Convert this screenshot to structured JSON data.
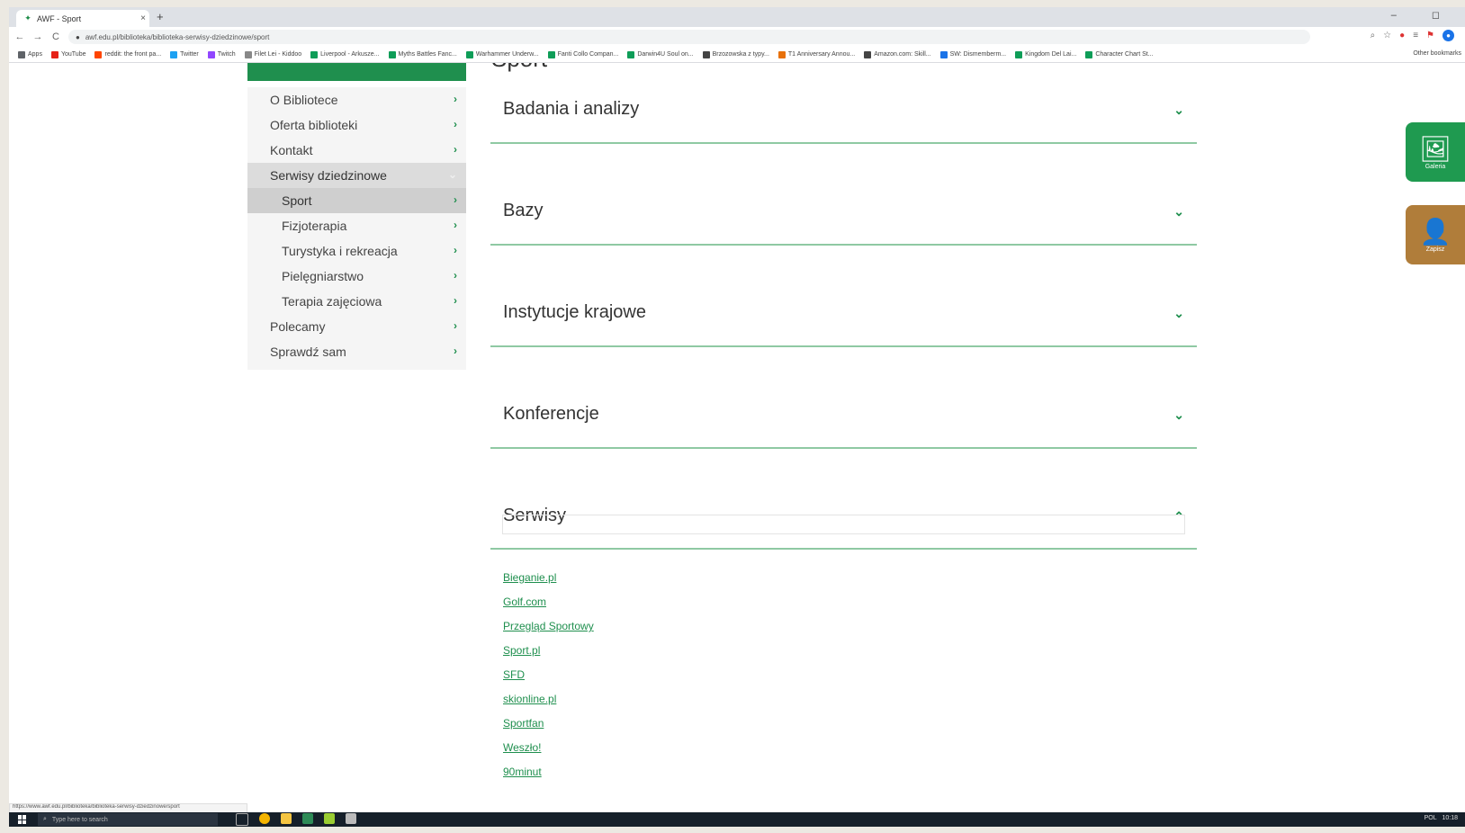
{
  "browser": {
    "tab_title": "AWF - Sport",
    "tab_close": "×",
    "new_tab": "+",
    "window_controls": "–  ◻",
    "nav": {
      "back": "←",
      "forward": "→",
      "reload": "C"
    },
    "url": "awf.edu.pl/biblioteka/biblioteka-serwisy-dziedzinowe/sport",
    "bookmarks": [
      {
        "label": "Apps",
        "color": "#5f6368"
      },
      {
        "label": "YouTube",
        "color": "#e62117"
      },
      {
        "label": "reddit: the front pa...",
        "color": "#ff4500"
      },
      {
        "label": "Twitter",
        "color": "#1da1f2"
      },
      {
        "label": "Twitch",
        "color": "#9146ff"
      },
      {
        "label": "Filet Lei - Kiddoo",
        "color": "#888888"
      },
      {
        "label": "Liverpool - Arkusze...",
        "color": "#0f9d58"
      },
      {
        "label": "Myths Battles Fanc...",
        "color": "#0f9d58"
      },
      {
        "label": "Warhammer Underw...",
        "color": "#0f9d58"
      },
      {
        "label": "Fanti Collo Compan...",
        "color": "#0f9d58"
      },
      {
        "label": "Darwin4U Soul on...",
        "color": "#0f9d58"
      },
      {
        "label": "Brzozowska z typy...",
        "color": "#444444"
      },
      {
        "label": "T1 Anniversary Annou...",
        "color": "#e8710a"
      },
      {
        "label": "Amazon.com: Skill...",
        "color": "#444444"
      },
      {
        "label": "SW: Dismemberm...",
        "color": "#1a73e8"
      },
      {
        "label": "Kingdom Del Lai...",
        "color": "#0f9d58"
      },
      {
        "label": "Character Chart St...",
        "color": "#0f9d58"
      }
    ],
    "other_bookmarks": "Other bookmarks",
    "status_url": "https://www.awf.edu.pl/biblioteka/biblioteka-serwisy-dziedzinowe/sport"
  },
  "page": {
    "title": "Sport",
    "sidebar": {
      "items": [
        {
          "label": "O Bibliotece",
          "level": "top",
          "state": "normal",
          "chev": "›"
        },
        {
          "label": "Oferta biblioteki",
          "level": "top",
          "state": "normal",
          "chev": "›"
        },
        {
          "label": "Kontakt",
          "level": "top",
          "state": "normal",
          "chev": "›"
        },
        {
          "label": "Serwisy dziedzinowe",
          "level": "top",
          "state": "active-parent",
          "chev": "⌄"
        },
        {
          "label": "Sport",
          "level": "sub",
          "state": "active",
          "chev": "›"
        },
        {
          "label": "Fizjoterapia",
          "level": "sub",
          "state": "normal",
          "chev": "›"
        },
        {
          "label": "Turystyka i rekreacja",
          "level": "sub",
          "state": "normal",
          "chev": "›"
        },
        {
          "label": "Pielęgniarstwo",
          "level": "sub",
          "state": "normal",
          "chev": "›"
        },
        {
          "label": "Terapia zajęciowa",
          "level": "sub",
          "state": "normal",
          "chev": "›"
        },
        {
          "label": "Polecamy",
          "level": "top",
          "state": "normal",
          "chev": "›"
        },
        {
          "label": "Sprawdź sam",
          "level": "top",
          "state": "normal",
          "chev": "›"
        }
      ]
    },
    "sections": [
      {
        "label": "Badania i analizy",
        "expanded": false,
        "chev": "⌄"
      },
      {
        "label": "Bazy",
        "expanded": false,
        "chev": "⌄"
      },
      {
        "label": "Instytucje krajowe",
        "expanded": false,
        "chev": "⌄"
      },
      {
        "label": "Konferencje",
        "expanded": false,
        "chev": "⌄"
      },
      {
        "label": "Serwisy",
        "expanded": true,
        "chev": "⌃"
      }
    ],
    "serwisy_links": [
      "Bieganie.pl",
      "Golf.com",
      "Przegląd Sportowy",
      "Sport.pl",
      "SFD",
      "skionline.pl",
      "Sportfan",
      "Weszło!",
      "90minut"
    ],
    "side_buttons": [
      {
        "label": "Galeria",
        "icon": "gallery-icon",
        "color": "#1f9a50"
      },
      {
        "label": "Zapisz",
        "icon": "user-icon",
        "color": "#b07d3a"
      }
    ],
    "colors": {
      "accent": "#1f8f4e",
      "section_rule": "#8fc9a3"
    }
  },
  "taskbar": {
    "search_placeholder": "Type here to search",
    "tray_lang": "POL",
    "tray_time": "10:18"
  }
}
